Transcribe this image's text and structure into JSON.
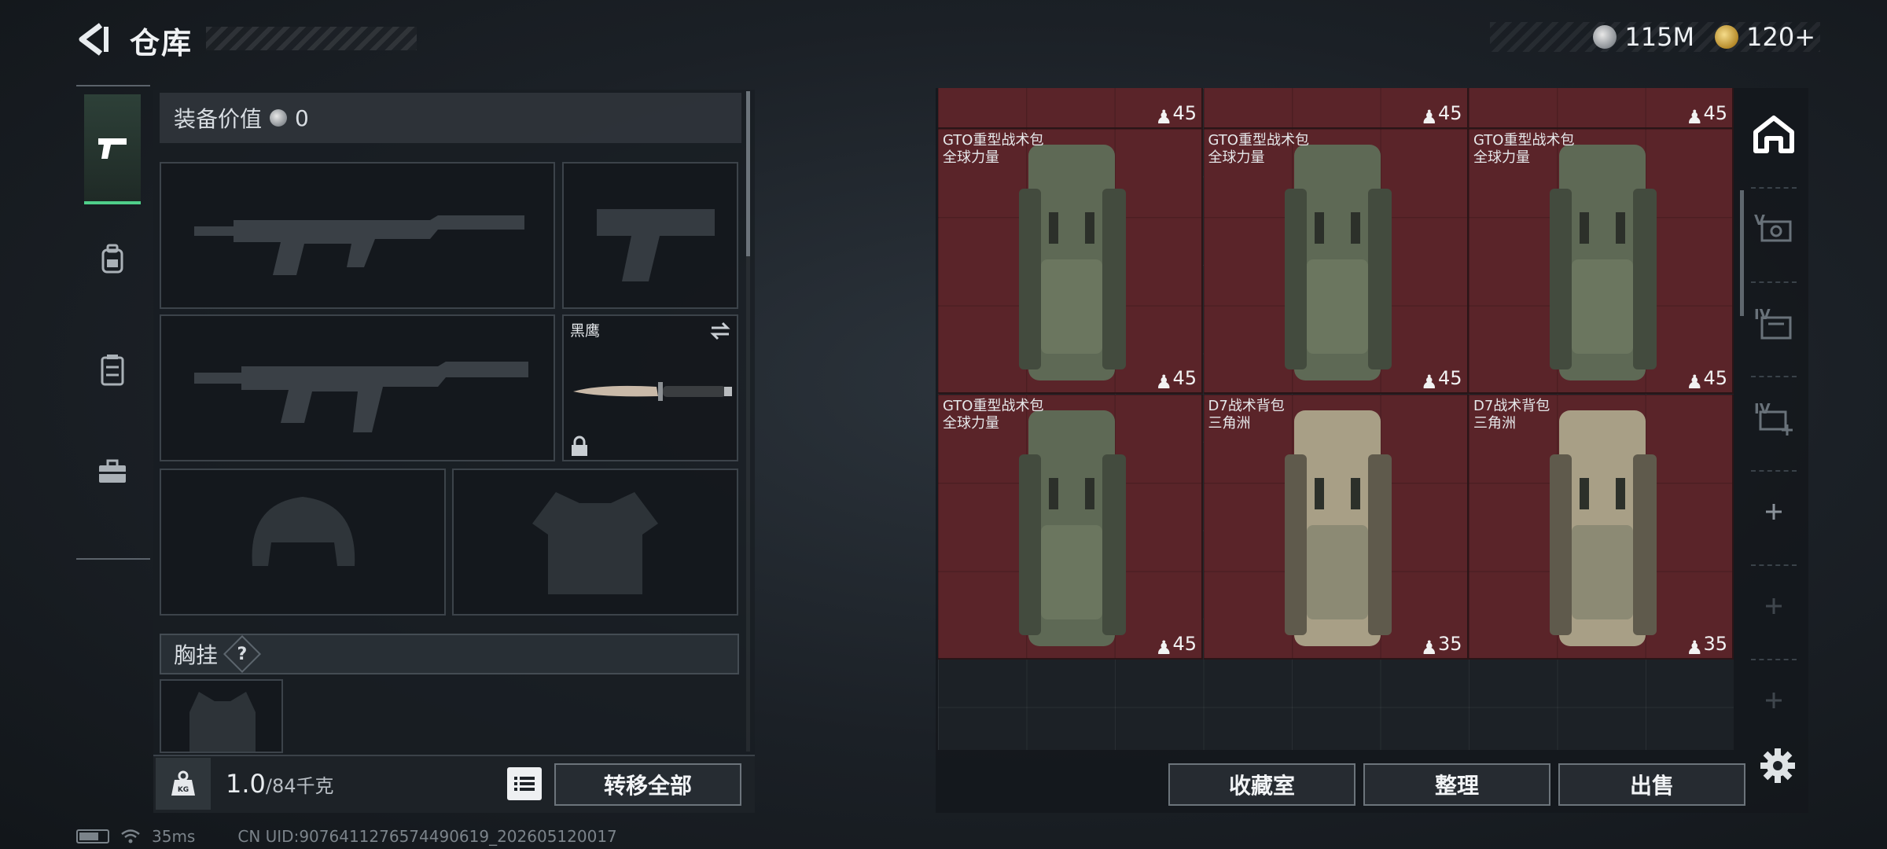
{
  "header": {
    "title": "仓库",
    "currencies": [
      {
        "icon": "silver-coin-icon",
        "value": "115M"
      },
      {
        "icon": "gold-coin-icon",
        "value": "120+"
      }
    ]
  },
  "tabs": [
    {
      "icon": "pistol-icon",
      "active": true
    },
    {
      "icon": "backpack-icon",
      "active": false
    },
    {
      "icon": "vest-icon",
      "active": false
    },
    {
      "icon": "toolbox-icon",
      "active": false
    }
  ],
  "equipment": {
    "value_label": "装备价值",
    "value": "0",
    "knife_name": "黑鹰",
    "chest_rig_label": "胸挂",
    "help_mark": "?",
    "weight_current": "1.0",
    "weight_max": "/84千克",
    "transfer_all_label": "转移全部"
  },
  "storage": {
    "top_row_capacities": [
      "45",
      "45",
      "45"
    ],
    "items": [
      {
        "name": "GTO重型战术包",
        "sub": "全球力量",
        "capacity": "45",
        "variant": "green"
      },
      {
        "name": "GTO重型战术包",
        "sub": "全球力量",
        "capacity": "45",
        "variant": "green"
      },
      {
        "name": "GTO重型战术包",
        "sub": "全球力量",
        "capacity": "45",
        "variant": "green"
      },
      {
        "name": "GTO重型战术包",
        "sub": "全球力量",
        "capacity": "45",
        "variant": "green"
      },
      {
        "name": "D7战术背包",
        "sub": "三角洲",
        "capacity": "35",
        "variant": "tan"
      },
      {
        "name": "D7战术背包",
        "sub": "三角洲",
        "capacity": "35",
        "variant": "tan"
      }
    ],
    "buttons": {
      "collection": "收藏室",
      "organize": "整理",
      "sell": "出售"
    },
    "rail_icons": [
      "home-icon",
      "storage-v-icon",
      "storage-iv-icon",
      "storage-iv-plus-icon",
      "add-icon",
      "add-icon",
      "add-icon"
    ]
  },
  "status": {
    "ping": "35ms",
    "uid": "CN UID:9076411276574490619_202605120017"
  },
  "colors": {
    "accent_green": "#4fcf8a",
    "item_red": "#5a2429"
  }
}
